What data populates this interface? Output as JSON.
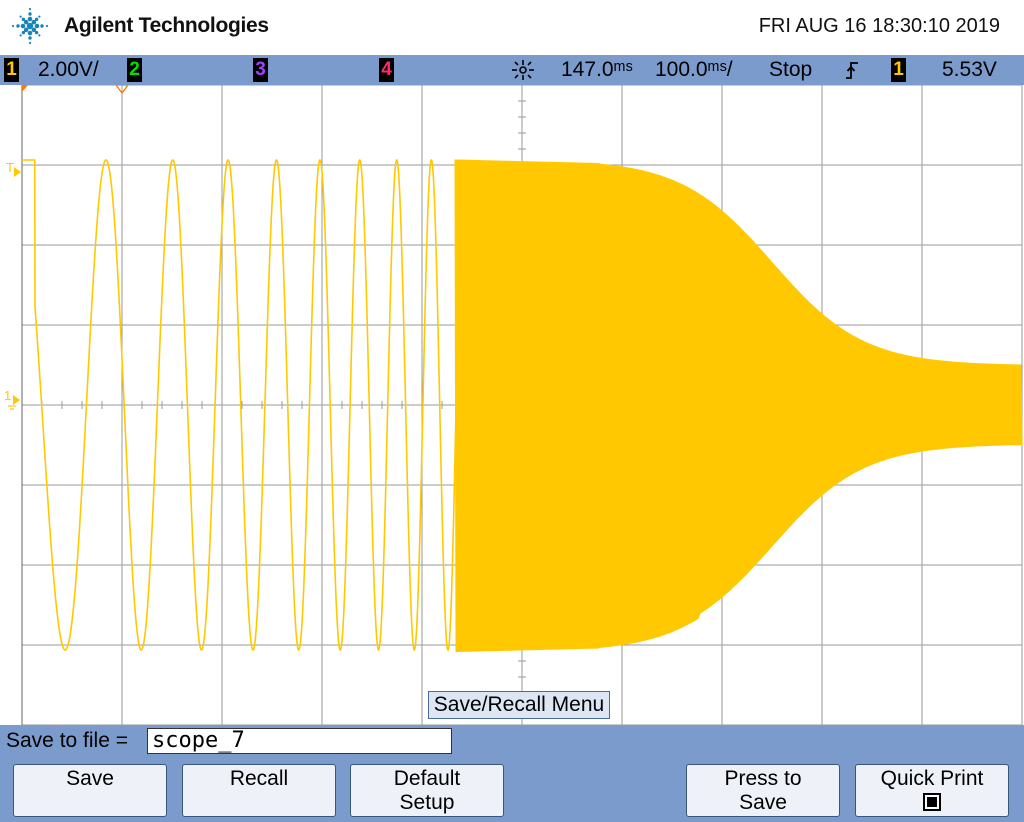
{
  "header": {
    "brand": "Agilent Technologies",
    "datetime": "FRI AUG 16 18:30:10 2019"
  },
  "status": {
    "ch1_num": "1",
    "ch1_scale": "2.00V/",
    "ch2_num": "2",
    "ch3_num": "3",
    "ch4_num": "4",
    "delay": "147.0ᵐˢ",
    "timebase": "100.0ᵐˢ/",
    "run_state": "Stop",
    "trigger_slope": "ƒ",
    "trig_src": "1",
    "trig_level": "5.53V"
  },
  "screen": {
    "marker_T": "T",
    "marker_1": "1",
    "menu_title": "Save/Recall Menu"
  },
  "save": {
    "label": "Save to file =",
    "filename": "scope_7"
  },
  "softkeys": {
    "save": "Save",
    "recall": "Recall",
    "default_line1": "Default",
    "default_line2": "Setup",
    "press_line1": "Press to",
    "press_line2": "Save",
    "quick_print": "Quick Print"
  },
  "colors": {
    "ch1": "#ffc800",
    "ch2": "#00e000",
    "ch3": "#a040ff",
    "ch4": "#ff2a6a",
    "bar": "#7b9bcc",
    "grid": "#9a9a9a"
  },
  "icons": {
    "logo": "agilent-spark-icon",
    "trigger": "trigger-edge-icon",
    "delay": "delay-sunburst-icon"
  }
}
